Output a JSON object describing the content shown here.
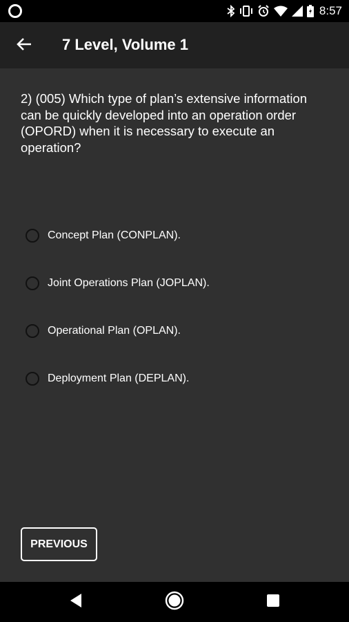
{
  "status_bar": {
    "time": "8:57",
    "icons": [
      "notification-circle-icon",
      "bluetooth-icon",
      "vibrate-icon",
      "alarm-icon",
      "wifi-icon",
      "cell-signal-icon",
      "battery-icon"
    ]
  },
  "app_bar": {
    "back_icon": "arrow-left-icon",
    "title": "7 Level, Volume 1"
  },
  "question": {
    "text": "2) (005) Which type of plan’s extensive information can be quickly developed into an operation order (OPORD) when it is necessary to execute an operation?"
  },
  "options": [
    {
      "label": "Concept Plan (CONPLAN).",
      "selected": false
    },
    {
      "label": "Joint Operations Plan (JOPLAN).",
      "selected": false
    },
    {
      "label": "Operational Plan (OPLAN).",
      "selected": false
    },
    {
      "label": "Deployment Plan (DEPLAN).",
      "selected": false
    }
  ],
  "buttons": {
    "previous_label": "PREVIOUS"
  },
  "nav_bar": {
    "icons": [
      "nav-back-icon",
      "nav-home-icon",
      "nav-recents-icon"
    ]
  },
  "colors": {
    "background": "#303030",
    "app_bar": "#212121",
    "status_bar": "#000000",
    "text": "#ffffff"
  }
}
